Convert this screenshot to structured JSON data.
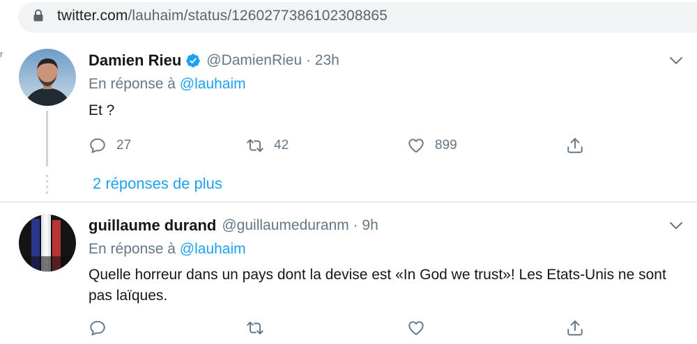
{
  "browser": {
    "url_host": "twitter.com",
    "url_path": "/lauhaim/status/1260277386102308865"
  },
  "colors": {
    "accent": "#1da1f2",
    "muted_text": "#657786",
    "primary_text": "#14171a",
    "divider": "#e6ecf0"
  },
  "edge_mark": "r",
  "tweets": [
    {
      "name": "Damien Rieu",
      "verified": true,
      "handle_time": "@DamienRieu · 23h",
      "reply_prefix": "En réponse à",
      "reply_to": "@lauhaim",
      "text": "Et ?",
      "replies": "27",
      "retweets": "42",
      "likes": "899"
    },
    {
      "name": "guillaume durand",
      "verified": false,
      "handle_time": "@guillaumeduranm · 9h",
      "reply_prefix": "En réponse à",
      "reply_to": "@lauhaim",
      "text": "Quelle horreur dans un pays dont la devise est «In God we trust»! Les Etats-Unis ne sont pas laïques.",
      "replies": "",
      "retweets": "",
      "likes": ""
    }
  ],
  "thread": {
    "more_replies_label": "2 réponses de plus"
  },
  "icons": {
    "lock": "lock-icon",
    "verified": "verified-badge-icon",
    "caret": "chevron-down-icon",
    "reply": "reply-icon",
    "retweet": "retweet-icon",
    "like": "heart-icon",
    "share": "share-icon"
  }
}
